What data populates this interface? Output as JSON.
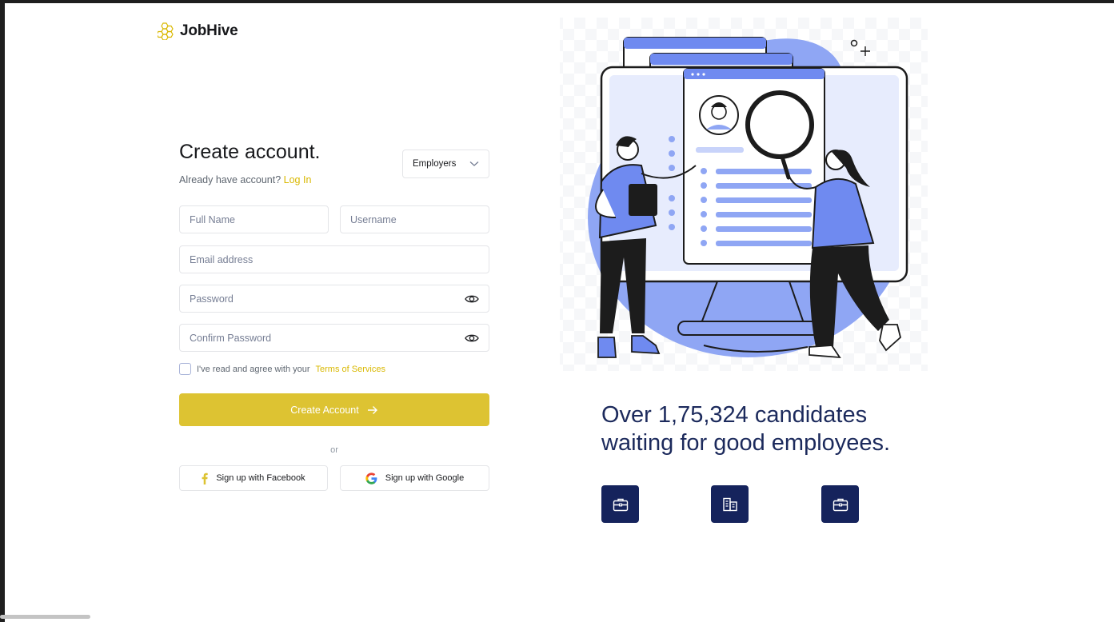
{
  "brand": {
    "name": "JobHive",
    "accent": "#ddc332",
    "navy": "#15235c"
  },
  "form": {
    "title": "Create account.",
    "login_prompt": "Already have account?",
    "login_link": "Log In",
    "account_type": {
      "selected": "Employers",
      "icon": "chevron-down-icon"
    },
    "fields": {
      "full_name": {
        "placeholder": "Full Name",
        "value": ""
      },
      "username": {
        "placeholder": "Username",
        "value": ""
      },
      "email": {
        "placeholder": "Email address",
        "value": ""
      },
      "password": {
        "placeholder": "Password",
        "value": "",
        "icon": "eye-icon"
      },
      "confirm_password": {
        "placeholder": "Confirm Password",
        "value": "",
        "icon": "eye-icon"
      }
    },
    "terms": {
      "checked": false,
      "text": "I've read and agree with your",
      "link": "Terms of Services"
    },
    "submit_label": "Create Account",
    "divider": "or",
    "social": {
      "facebook_label": "Sign up with Facebook",
      "google_label": "Sign up with Google"
    }
  },
  "hero": {
    "headline_line1": "Over 1,75,324 candidates",
    "headline_line2": "waiting for good employees.",
    "stat_icons": [
      "briefcase-icon",
      "building-icon",
      "briefcase-icon"
    ]
  }
}
